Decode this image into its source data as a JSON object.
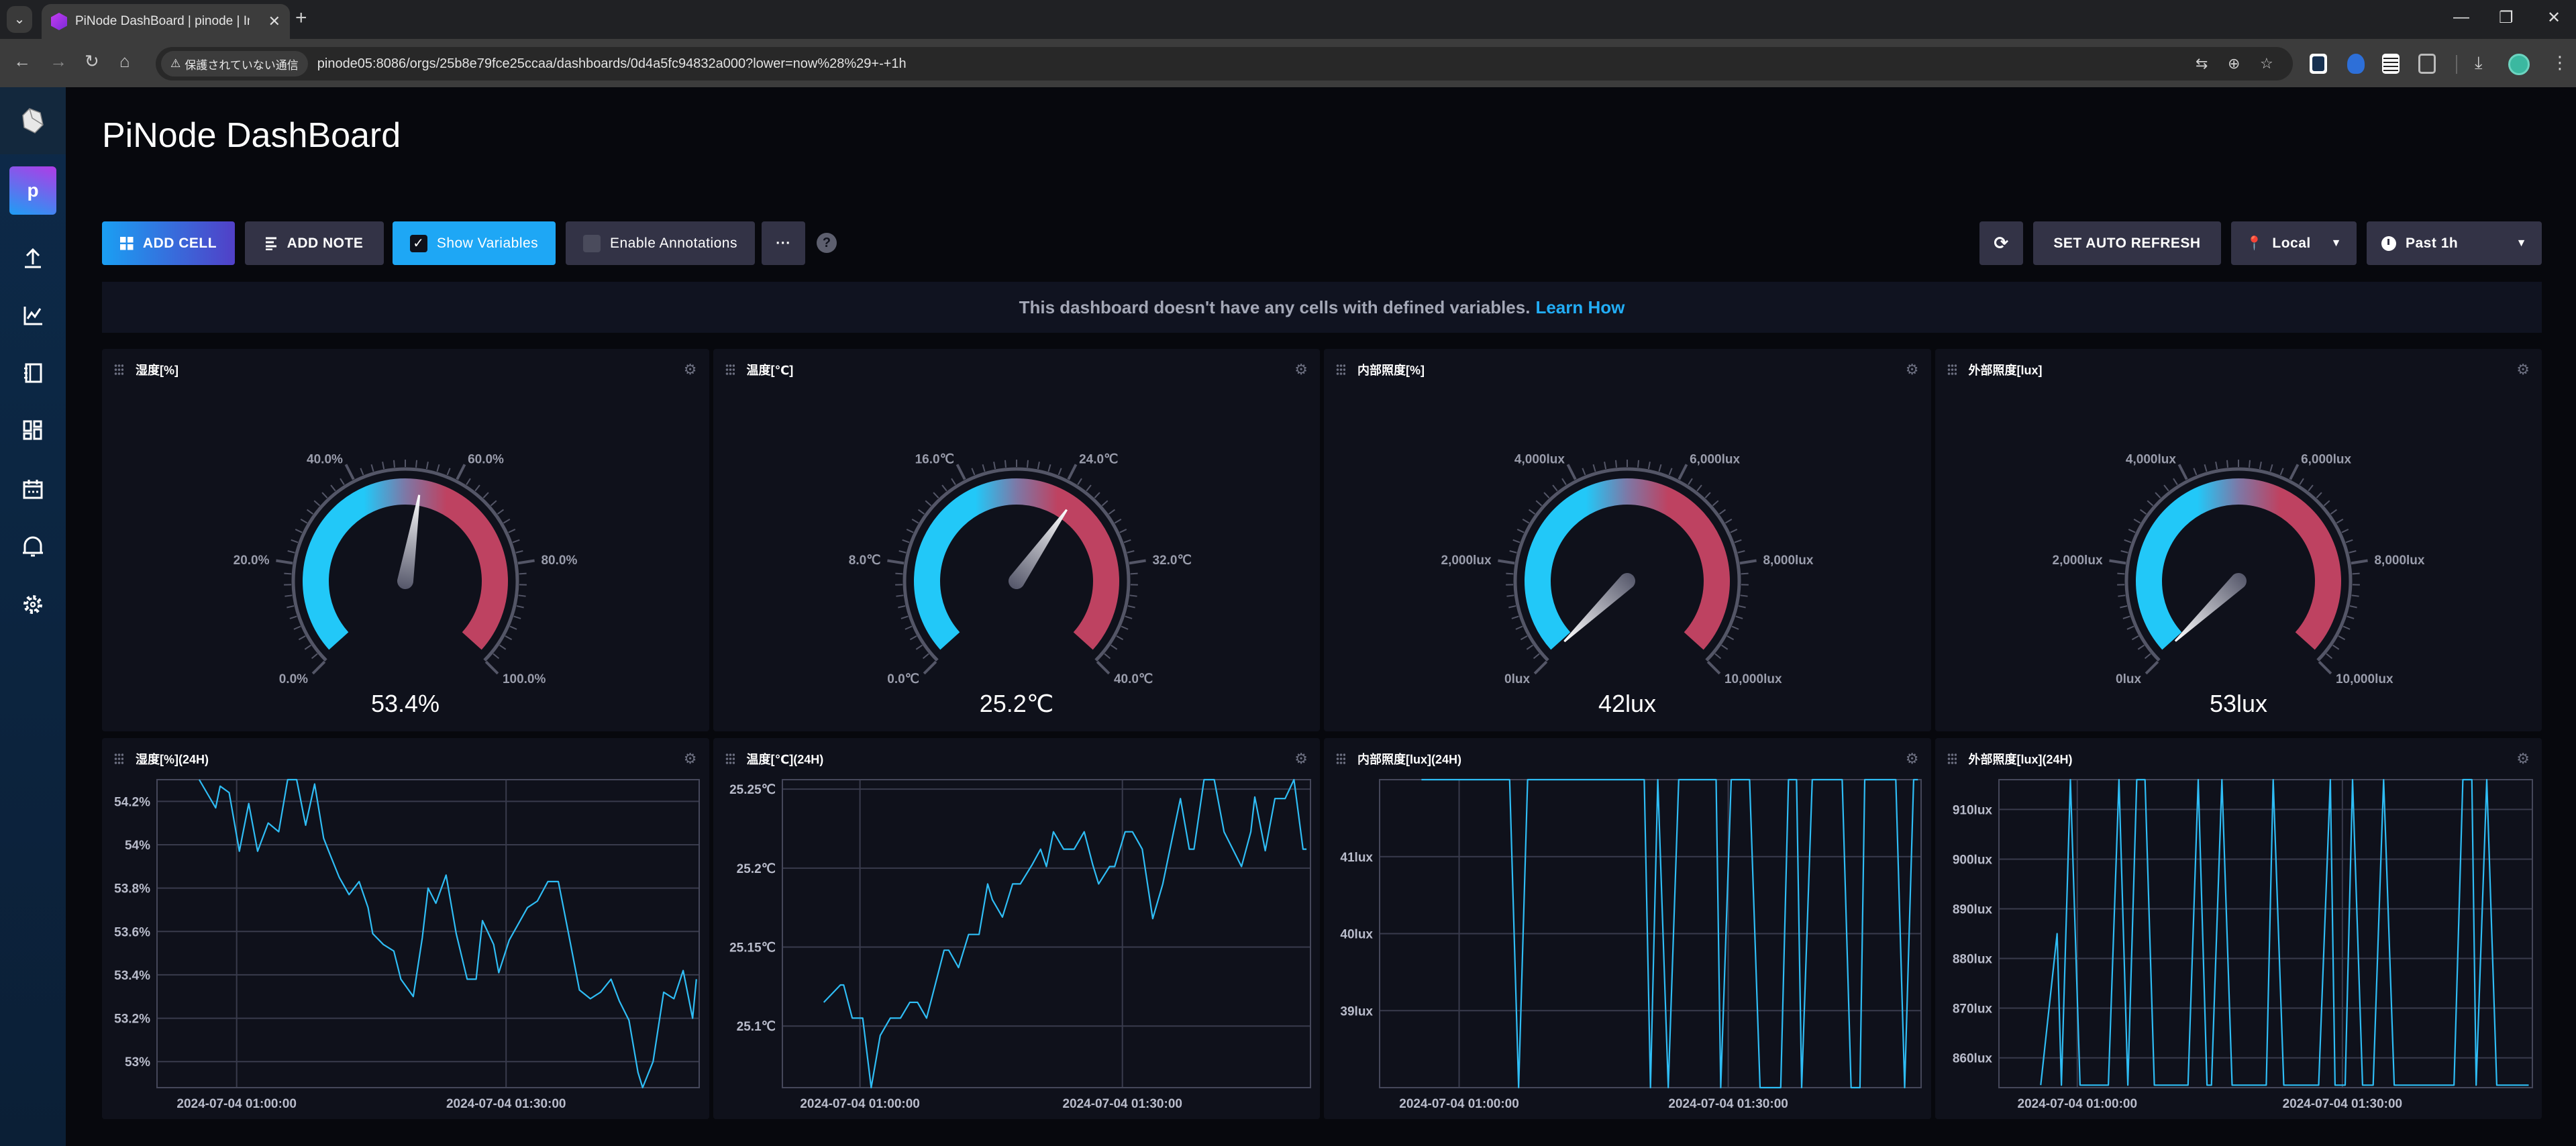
{
  "browser": {
    "tab_title": "PiNode DashBoard | pinode | In",
    "security_label": "保護されていない通信",
    "url": "pinode05:8086/orgs/25b8e79fce25ccaa/dashboards/0d4a5fc94832a000?lower=now%28%29+-+1h"
  },
  "sidebar": {
    "org_initial": "p",
    "items": [
      "upload-icon",
      "data-explorer-icon",
      "notebook-icon",
      "dashboards-icon",
      "tasks-calendar-icon",
      "alerts-bell-icon",
      "settings-gear-icon"
    ]
  },
  "header": {
    "title": "PiNode DashBoard"
  },
  "toolbar": {
    "add_cell": "ADD CELL",
    "add_note": "ADD NOTE",
    "show_variables": "Show Variables",
    "show_variables_checked": true,
    "enable_annotations": "Enable Annotations",
    "enable_annotations_checked": false,
    "more": "···",
    "help": "?",
    "auto_refresh": "SET AUTO REFRESH",
    "timezone": "Local",
    "time_range": "Past 1h"
  },
  "banner": {
    "text": "This dashboard doesn't have any cells with defined variables.",
    "link": "Learn How"
  },
  "colors": {
    "accent": "#22adf6",
    "gauge_low": "#22c8f8",
    "gauge_high": "#be4261",
    "line": "#2fbdf5",
    "cell_bg": "#0f111b"
  },
  "gauges": [
    {
      "title": "湿度[%]",
      "min": 0,
      "max": 100,
      "value": 53.4,
      "value_label": "53.4%",
      "tick_labels": [
        "0.0%",
        "20.0%",
        "40.0%",
        "60.0%",
        "80.0%",
        "100.0%"
      ]
    },
    {
      "title": "温度[℃]",
      "min": 0,
      "max": 40,
      "value": 25.2,
      "value_label": "25.2℃",
      "tick_labels": [
        "0.0℃",
        "8.0℃",
        "16.0℃",
        "24.0℃",
        "32.0℃",
        "40.0℃"
      ]
    },
    {
      "title": "内部照度[%]",
      "min": 0,
      "max": 10000,
      "value": 42,
      "value_label": "42lux",
      "tick_labels": [
        "0lux",
        "2,000lux",
        "4,000lux",
        "6,000lux",
        "8,000lux",
        "10,000lux"
      ]
    },
    {
      "title": "外部照度[lux]",
      "min": 0,
      "max": 10000,
      "value": 53,
      "value_label": "53lux",
      "tick_labels": [
        "0lux",
        "2,000lux",
        "4,000lux",
        "6,000lux",
        "8,000lux",
        "10,000lux"
      ]
    }
  ],
  "chart_data": [
    {
      "type": "line",
      "title": "湿度[%](24H)",
      "date": "2024-07-04",
      "xlim": [
        "00:51:08",
        "01:51:30"
      ],
      "ylim": [
        52.88,
        54.3
      ],
      "grid": true,
      "x_ticks": [
        {
          "value": "01:00:00",
          "label": "2024-07-04 01:00:00"
        },
        {
          "value": "01:30:00",
          "label": "2024-07-04 01:30:00"
        }
      ],
      "y_ticks": [
        {
          "value": 53,
          "label": "53%"
        },
        {
          "value": 53.2,
          "label": "53.2%"
        },
        {
          "value": 53.4,
          "label": "53.4%"
        },
        {
          "value": 53.6,
          "label": "53.6%"
        },
        {
          "value": 53.8,
          "label": "53.8%"
        },
        {
          "value": 54,
          "label": "54%"
        },
        {
          "value": 54.2,
          "label": "54.2%"
        }
      ],
      "series": [
        {
          "points": [
            [
              "00:55:50",
              54.3
            ],
            [
              "00:57:40",
              54.17
            ],
            [
              "00:58:10",
              54.27
            ],
            [
              "00:59:10",
              54.24
            ],
            [
              "01:00:18",
              53.97
            ],
            [
              "01:01:21",
              54.19
            ],
            [
              "01:02:20",
              53.97
            ],
            [
              "01:03:31",
              54.1
            ],
            [
              "01:04:41",
              54.06
            ],
            [
              "01:05:41",
              54.3
            ],
            [
              "01:06:41",
              54.3
            ],
            [
              "01:07:41",
              54.09
            ],
            [
              "01:08:41",
              54.28
            ],
            [
              "01:09:41",
              54.03
            ],
            [
              "01:10:15",
              53.97
            ],
            [
              "01:11:25",
              53.85
            ],
            [
              "01:12:31",
              53.77
            ],
            [
              "01:13:38",
              53.83
            ],
            [
              "01:14:38",
              53.71
            ],
            [
              "01:15:09",
              53.59
            ],
            [
              "01:16:20",
              53.54
            ],
            [
              "01:17:30",
              53.51
            ],
            [
              "01:18:17",
              53.38
            ],
            [
              "01:19:40",
              53.3
            ],
            [
              "01:20:40",
              53.57
            ],
            [
              "01:21:19",
              53.8
            ],
            [
              "01:22:11",
              53.73
            ],
            [
              "01:23:19",
              53.86
            ],
            [
              "01:24:27",
              53.59
            ],
            [
              "01:25:40",
              53.38
            ],
            [
              "01:26:40",
              53.38
            ],
            [
              "01:27:22",
              53.65
            ],
            [
              "01:28:37",
              53.54
            ],
            [
              "01:29:11",
              53.41
            ],
            [
              "01:30:21",
              53.56
            ],
            [
              "01:32:23",
              53.71
            ],
            [
              "01:33:29",
              53.74
            ],
            [
              "01:34:39",
              53.83
            ],
            [
              "01:35:49",
              53.83
            ],
            [
              "01:36:57",
              53.59
            ],
            [
              "01:38:10",
              53.33
            ],
            [
              "01:39:23",
              53.29
            ],
            [
              "01:40:31",
              53.32
            ],
            [
              "01:41:41",
              53.38
            ],
            [
              "01:42:36",
              53.28
            ],
            [
              "01:43:41",
              53.19
            ],
            [
              "01:44:41",
              52.95
            ],
            [
              "01:45:12",
              52.88
            ],
            [
              "01:46:22",
              53.0
            ],
            [
              "01:47:33",
              53.32
            ],
            [
              "01:48:41",
              53.29
            ],
            [
              "01:49:43",
              53.42
            ],
            [
              "01:50:46",
              53.2
            ],
            [
              "01:51:11",
              53.38
            ]
          ]
        }
      ]
    },
    {
      "type": "line",
      "title": "温度[℃](24H)",
      "date": "2024-07-04",
      "xlim": [
        "00:51:08",
        "01:51:30"
      ],
      "ylim": [
        25.061,
        25.256
      ],
      "grid": true,
      "x_ticks": [
        {
          "value": "01:00:00",
          "label": "2024-07-04 01:00:00"
        },
        {
          "value": "01:30:00",
          "label": "2024-07-04 01:30:00"
        }
      ],
      "y_ticks": [
        {
          "value": 25.1,
          "label": "25.1℃"
        },
        {
          "value": 25.15,
          "label": "25.15℃"
        },
        {
          "value": 25.2,
          "label": "25.2℃"
        },
        {
          "value": 25.25,
          "label": "25.25℃"
        }
      ],
      "series": [
        {
          "points": [
            [
              "00:55:52",
              25.115
            ],
            [
              "00:57:46",
              25.126
            ],
            [
              "00:58:08",
              25.126
            ],
            [
              "00:59:07",
              25.105
            ],
            [
              "01:00:19",
              25.105
            ],
            [
              "01:01:17",
              25.061
            ],
            [
              "01:02:19",
              25.094
            ],
            [
              "01:03:28",
              25.105
            ],
            [
              "01:04:38",
              25.105
            ],
            [
              "01:05:42",
              25.115
            ],
            [
              "01:06:35",
              25.115
            ],
            [
              "01:07:37",
              25.105
            ],
            [
              "01:09:37",
              25.148
            ],
            [
              "01:10:09",
              25.148
            ],
            [
              "01:11:16",
              25.137
            ],
            [
              "01:12:25",
              25.158
            ],
            [
              "01:13:37",
              25.158
            ],
            [
              "01:14:36",
              25.19
            ],
            [
              "01:15:08",
              25.18
            ],
            [
              "01:16:17",
              25.169
            ],
            [
              "01:17:27",
              25.19
            ],
            [
              "01:18:20",
              25.19
            ],
            [
              "01:19:40",
              25.202
            ],
            [
              "01:20:39",
              25.212
            ],
            [
              "01:21:19",
              25.201
            ],
            [
              "01:22:07",
              25.223
            ],
            [
              "01:23:17",
              25.212
            ],
            [
              "01:24:29",
              25.212
            ],
            [
              "01:25:38",
              25.223
            ],
            [
              "01:26:37",
              25.202
            ],
            [
              "01:27:17",
              25.19
            ],
            [
              "01:28:32",
              25.201
            ],
            [
              "01:29:07",
              25.201
            ],
            [
              "01:30:19",
              25.223
            ],
            [
              "01:31:09",
              25.223
            ],
            [
              "01:32:16",
              25.212
            ],
            [
              "01:33:28",
              25.168
            ],
            [
              "01:34:37",
              25.19
            ],
            [
              "01:36:38",
              25.244
            ],
            [
              "01:37:39",
              25.212
            ],
            [
              "01:38:11",
              25.212
            ],
            [
              "01:39:20",
              25.256
            ],
            [
              "01:40:30",
              25.256
            ],
            [
              "01:41:37",
              25.223
            ],
            [
              "01:43:37",
              25.201
            ],
            [
              "01:44:41",
              25.223
            ],
            [
              "01:45:08",
              25.245
            ],
            [
              "01:46:20",
              25.211
            ],
            [
              "01:47:26",
              25.244
            ],
            [
              "01:48:36",
              25.244
            ],
            [
              "01:49:37",
              25.256
            ],
            [
              "01:50:39",
              25.212
            ],
            [
              "01:51:03",
              25.212
            ]
          ]
        }
      ]
    },
    {
      "type": "line",
      "title": "内部照度[lux](24H)",
      "date": "2024-07-04",
      "xlim": [
        "00:51:08",
        "01:51:30"
      ],
      "ylim": [
        38,
        42
      ],
      "grid": true,
      "x_ticks": [
        {
          "value": "01:00:00",
          "label": "2024-07-04 01:00:00"
        },
        {
          "value": "01:30:00",
          "label": "2024-07-04 01:30:00"
        }
      ],
      "y_ticks": [
        {
          "value": 39,
          "label": "39lux"
        },
        {
          "value": 40,
          "label": "40lux"
        },
        {
          "value": 41,
          "label": "41lux"
        }
      ],
      "series": [
        {
          "points": [
            [
              "00:55:48",
              42
            ],
            [
              "01:05:38",
              42
            ],
            [
              "01:06:38",
              38
            ],
            [
              "01:07:38",
              42
            ],
            [
              "01:20:38",
              42
            ],
            [
              "01:21:20",
              38
            ],
            [
              "01:22:09",
              42
            ],
            [
              "01:23:19",
              38
            ],
            [
              "01:24:29",
              42
            ],
            [
              "01:28:39",
              42
            ],
            [
              "01:29:10",
              38
            ],
            [
              "01:30:20",
              42
            ],
            [
              "01:32:23",
              42
            ],
            [
              "01:33:33",
              38
            ],
            [
              "01:35:51",
              38
            ],
            [
              "01:36:43",
              42
            ],
            [
              "01:37:37",
              42
            ],
            [
              "01:38:11",
              38
            ],
            [
              "01:39:22",
              42
            ],
            [
              "01:42:42",
              42
            ],
            [
              "01:43:42",
              38
            ],
            [
              "01:44:41",
              38
            ],
            [
              "01:45:13",
              42
            ],
            [
              "01:48:41",
              42
            ],
            [
              "01:49:40",
              38
            ],
            [
              "01:50:40",
              42
            ],
            [
              "01:51:09",
              42
            ]
          ]
        }
      ]
    },
    {
      "type": "line",
      "title": "外部照度[lux](24H)",
      "date": "2024-07-04",
      "xlim": [
        "00:51:08",
        "01:51:30"
      ],
      "ylim": [
        854,
        916
      ],
      "grid": true,
      "x_ticks": [
        {
          "value": "01:00:00",
          "label": "2024-07-04 01:00:00"
        },
        {
          "value": "01:30:00",
          "label": "2024-07-04 01:30:00"
        }
      ],
      "y_ticks": [
        {
          "value": 860,
          "label": "860lux"
        },
        {
          "value": 870,
          "label": "870lux"
        },
        {
          "value": 880,
          "label": "880lux"
        },
        {
          "value": 890,
          "label": "890lux"
        },
        {
          "value": 900,
          "label": "900lux"
        },
        {
          "value": 910,
          "label": "910lux"
        }
      ],
      "series": [
        {
          "points": [
            [
              "00:55:52",
              854.5
            ],
            [
              "00:57:43",
              885
            ],
            [
              "00:58:12",
              854.5
            ],
            [
              "00:59:13",
              916
            ],
            [
              "01:00:19",
              854.5
            ],
            [
              "01:03:31",
              854.5
            ],
            [
              "01:04:43",
              916
            ],
            [
              "01:05:43",
              854.5
            ],
            [
              "01:06:44",
              916
            ],
            [
              "01:07:40",
              916
            ],
            [
              "01:08:43",
              854.5
            ],
            [
              "01:12:32",
              854.5
            ],
            [
              "01:13:41",
              916
            ],
            [
              "01:14:41",
              854.5
            ],
            [
              "01:15:11",
              854.5
            ],
            [
              "01:16:22",
              916
            ],
            [
              "01:17:31",
              854.5
            ],
            [
              "01:21:23",
              854.5
            ],
            [
              "01:22:10",
              916
            ],
            [
              "01:23:22",
              854.5
            ],
            [
              "01:27:19",
              854.5
            ],
            [
              "01:28:38",
              916
            ],
            [
              "01:29:10",
              854.5
            ],
            [
              "01:30:19",
              854.5
            ],
            [
              "01:31:09",
              916
            ],
            [
              "01:32:17",
              854.5
            ],
            [
              "01:33:29",
              854.5
            ],
            [
              "01:34:40",
              916
            ],
            [
              "01:35:52",
              854.5
            ],
            [
              "01:42:38",
              854.5
            ],
            [
              "01:43:38",
              916
            ],
            [
              "01:44:39",
              916
            ],
            [
              "01:45:08",
              854.5
            ],
            [
              "01:46:20",
              916
            ],
            [
              "01:47:28",
              854.5
            ],
            [
              "01:51:05",
              854.5
            ]
          ]
        }
      ]
    }
  ]
}
